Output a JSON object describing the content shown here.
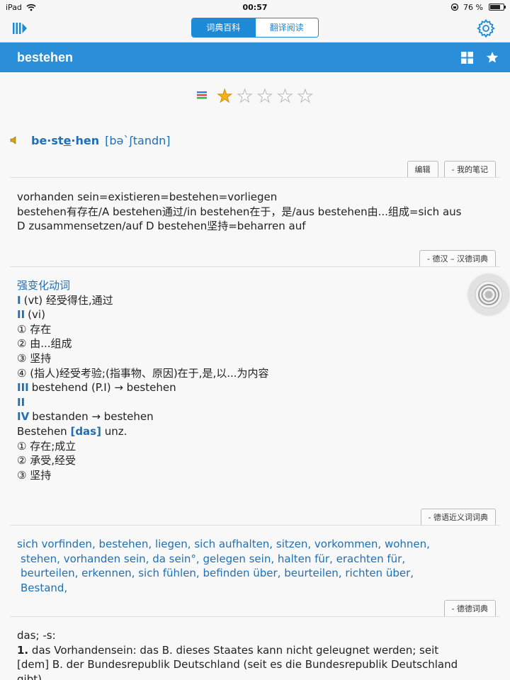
{
  "status": {
    "device": "iPad",
    "time": "00:57",
    "battery": "76 %",
    "battery_level": 0.76
  },
  "nav": {
    "tabs": [
      "词典百科",
      "翻译阅读"
    ],
    "active_tab": 0
  },
  "word": "bestehen",
  "rating": {
    "value": 1,
    "max": 5
  },
  "headword": {
    "syll1": "be·st",
    "syll_under": "e",
    "syll2": "·hen",
    "pron": "[bəˋʃtandn]"
  },
  "buttons": {
    "edit": "编辑",
    "notes": "- 我的笔记",
    "dict1": "- 德汉 – 汉德词典",
    "dict2": "- 德语近义词词典",
    "dict3": "- 德德词典"
  },
  "note_lines": [
    "vorhanden sein=existieren=bestehen=vorliegen",
    "bestehen有存在/A bestehen通过/in bestehen在于，是/aus bestehen由...组成=sich aus",
    "D zusammensetzen/auf D bestehen坚持=beharren auf"
  ],
  "dehan": {
    "type": "强变化动词",
    "l1_num": "I",
    "l1": "(vt) 经受得住,通过",
    "l2_num": "II",
    "l2": "(vi)",
    "l3": "① 存在",
    "l4": "② 由...组成",
    "l5": "③ 坚持",
    "l6": "④ (指人)经受考验;(指事物、原因)在于,是,以...为内容",
    "l7_num": "III",
    "l7": "bestehend (P.I) → bestehen",
    "l8_num": "II",
    "l9_num": "IV",
    "l9": "bestanden → bestehen",
    "l10a": "Bestehen",
    "l10b": "[das]",
    "l10c": "unz.",
    "l11": "① 存在;成立",
    "l12": "② 承受,经受",
    "l13": "③ 坚持"
  },
  "synonyms": [
    [
      "sich vorfinden,",
      "bestehen,",
      "liegen,",
      "sich aufhalten,",
      "sitzen,",
      "vorkommen,",
      "wohnen,"
    ],
    [
      "stehen,",
      "vorhanden sein,",
      "da sein°,",
      "gelegen sein,",
      "halten für,",
      "erachten für,"
    ],
    [
      "beurteilen,",
      "erkennen,",
      "sich fühlen,",
      "befinden über,",
      "beurteilen,",
      "richten über,"
    ],
    [
      "Bestand,"
    ]
  ],
  "dede": {
    "l1": "das; -s:",
    "num": "1.",
    "l2": "das Vorhandensein: das B. dieses Staates kann nicht geleugnet werden; seit",
    "l3": "[dem] B. der Bundesrepublik Deutschland (seit es die Bundesrepublik Deutschland",
    "l4": "gibt)."
  }
}
